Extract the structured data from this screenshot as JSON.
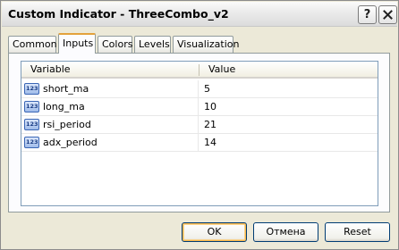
{
  "window": {
    "title": "Custom Indicator - ThreeCombo_v2",
    "help_label": "?",
    "close_icon": "close-icon"
  },
  "tabs": [
    {
      "label": "Common"
    },
    {
      "label": "Inputs",
      "active": true
    },
    {
      "label": "Colors"
    },
    {
      "label": "Levels"
    },
    {
      "label": "Visualization"
    }
  ],
  "grid": {
    "columns": [
      "Variable",
      "Value"
    ],
    "rows": [
      {
        "icon": "123-icon",
        "variable": "short_ma",
        "value": "5"
      },
      {
        "icon": "123-icon",
        "variable": "long_ma",
        "value": "10"
      },
      {
        "icon": "123-icon",
        "variable": "rsi_period",
        "value": "21"
      },
      {
        "icon": "123-icon",
        "variable": "adx_period",
        "value": "14"
      }
    ],
    "icon_text": "123"
  },
  "buttons": {
    "ok": "OK",
    "cancel": "Отмена",
    "reset": "Reset"
  },
  "colors": {
    "dialog_bg": "#ece9d8",
    "accent_tab": "#e3a23b",
    "button_border": "#003c74"
  }
}
